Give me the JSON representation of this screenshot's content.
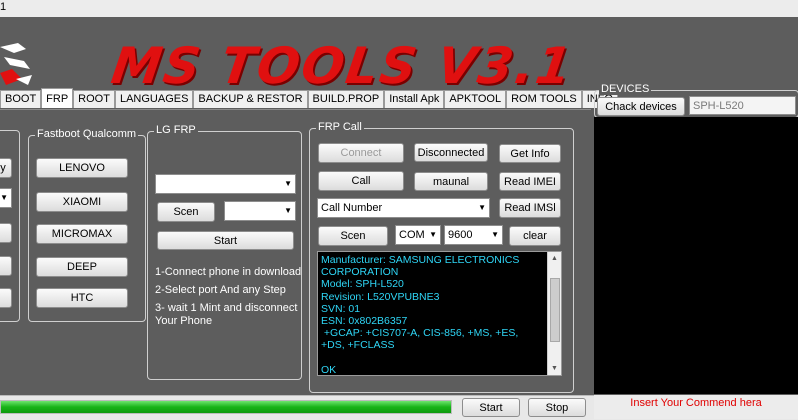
{
  "window": {
    "title_fragment": "1"
  },
  "banner": {
    "title": "MS TOOLS V3.1"
  },
  "tabs": [
    "BOOT",
    "FRP",
    "ROOT",
    "LANGUAGES",
    "BACKUP & RESTOR",
    "BUILD.PROP",
    "Install Apk",
    "APKTOOL",
    "ROM TOOLS",
    "INFO"
  ],
  "active_tab": "FRP",
  "left_group": {
    "partial_label": "y"
  },
  "fastboot": {
    "title": "Fastboot  Qualcomm",
    "buttons": [
      "LENOVO",
      "XIAOMI",
      "MICROMAX",
      "DEEP",
      "HTC"
    ]
  },
  "lg_frp": {
    "title": "LG FRP",
    "combo_value": "",
    "scan_label": "Scen",
    "port_combo_value": "",
    "start_label": "Start",
    "instructions": [
      "1-Connect phone in download",
      "2-Select port And any Step",
      "3- wait 1 Mint and disconnect",
      "Your Phone"
    ]
  },
  "frp_call": {
    "title": "FRP Call",
    "connect_label": "Connect",
    "status_label": "Disconnected",
    "get_info_label": "Get Info",
    "call_label": "Call",
    "manual_label": "maunal",
    "read_imei_label": "Read IMEI",
    "call_number_value": "Call Number",
    "read_imsi_label": "Read IMSl",
    "scan_label": "Scen",
    "com_value": "COM",
    "baud_value": "9600",
    "clear_label": "clear",
    "console_lines": [
      "Manufacturer: SAMSUNG ELECTRONICS",
      "CORPORATION",
      "Model: SPH-L520",
      "Revision: L520VPUBNE3",
      "SVN: 01",
      "ESN: 0x802B6357",
      " +GCAP: +CIS707-A, CIS-856, +MS, +ES,",
      "+DS, +FCLASS",
      "",
      "OK"
    ]
  },
  "devices": {
    "title": "DEVICES",
    "check_label": "Chack devices",
    "device_value": "SPH-L520"
  },
  "footer": {
    "progress_percent": 100,
    "start_label": "Start",
    "stop_label": "Stop",
    "command_hint": "Insert Your Commend hera"
  },
  "colors": {
    "panel_bg": "#5d5d5d",
    "banner_red": "#e01010",
    "console_text": "#2fd6f6",
    "progress_green": "#18b418",
    "hint_red": "#e00000"
  }
}
